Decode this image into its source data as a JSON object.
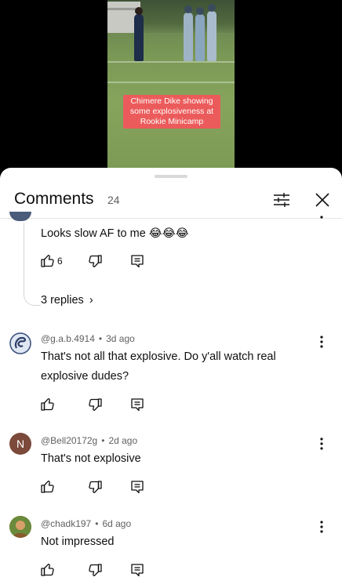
{
  "video": {
    "caption": "Chimere Dike showing some explosiveness at Rookie Minicamp"
  },
  "comments_sheet": {
    "title": "Comments",
    "count": "24",
    "icons": {
      "filter": "sliders-icon",
      "close": "close-icon"
    }
  },
  "comments": [
    {
      "text": "Looks slow AF to me 😂😂😂",
      "like_count": "6",
      "replies_label": "3 replies",
      "replies_chevron": "›"
    },
    {
      "handle": "@g.a.b.4914",
      "time": "3d ago",
      "text_line1": "That's not all that explosive. Do y'all watch real",
      "text_line2": "explosive dudes?"
    },
    {
      "handle": "@Bell20172g",
      "time": "2d ago",
      "avatar_letter": "N",
      "text": "That's not explosive"
    },
    {
      "handle": "@chadk197",
      "time": "6d ago",
      "text": "Not impressed"
    }
  ],
  "separator": "•",
  "colors": {
    "caption_bg": "#ec5b5b",
    "avatar_n_bg": "#7b4a3a",
    "muted_text": "#606060"
  }
}
